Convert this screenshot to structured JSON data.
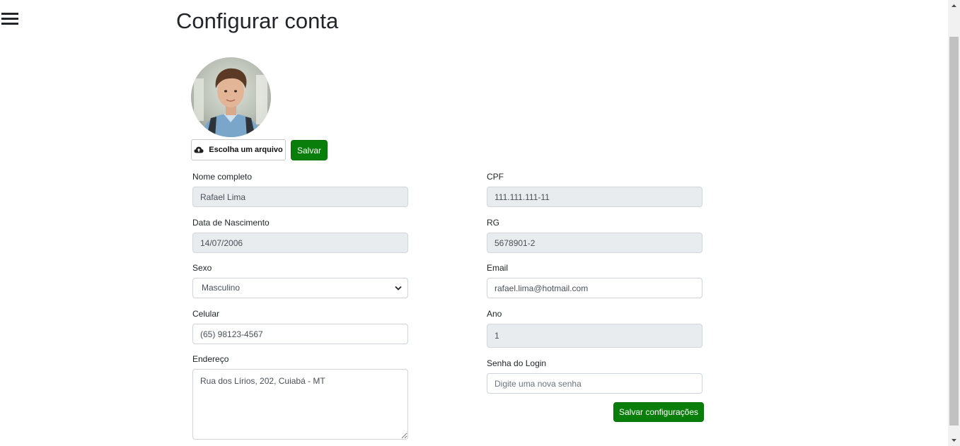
{
  "page": {
    "title": "Configurar conta"
  },
  "menu": {
    "icon": "hamburger-menu-icon"
  },
  "photo": {
    "choose_file_label": "Escolha um arquivo",
    "choose_file_icon": "cloud-upload-icon",
    "save_label": "Salvar"
  },
  "form": {
    "nome": {
      "label": "Nome completo",
      "value": "Rafael Lima"
    },
    "cpf": {
      "label": "CPF",
      "value": "111.111.111-11"
    },
    "nascimento": {
      "label": "Data de Nascimento",
      "value": "14/07/2006"
    },
    "rg": {
      "label": "RG",
      "value": "5678901-2"
    },
    "sexo": {
      "label": "Sexo",
      "value": "Masculino"
    },
    "email": {
      "label": "Email",
      "value": "rafael.lima@hotmail.com"
    },
    "celular": {
      "label": "Celular",
      "value": "(65) 98123-4567"
    },
    "ano": {
      "label": "Ano",
      "value": "1"
    },
    "endereco": {
      "label": "Endereço",
      "value": "Rua dos Lírios, 202, Cuiabá - MT"
    },
    "senha": {
      "label": "Senha do Login",
      "placeholder": "Digite uma nova senha"
    },
    "save_all_label": "Salvar configurações"
  },
  "colors": {
    "primary_button": "#0a7e0a",
    "disabled_input": "#e9ecef",
    "input_border": "#ced4da"
  }
}
